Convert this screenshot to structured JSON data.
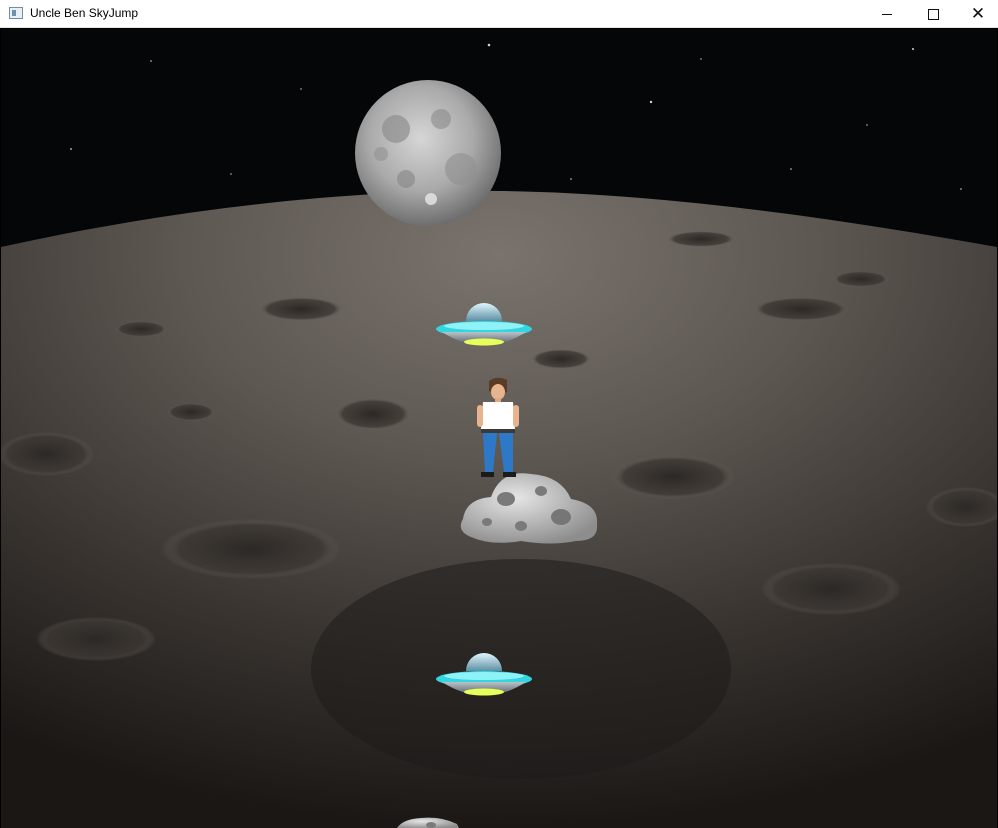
{
  "window": {
    "title": "Uncle Ben SkyJump",
    "app_icon": "window-app-icon",
    "controls": {
      "minimize_icon": "minimize-icon",
      "maximize_icon": "maximize-icon",
      "close_icon": "close-icon"
    }
  },
  "scene": {
    "background": "moon-surface-space",
    "sprites": [
      {
        "type": "full-moon"
      },
      {
        "type": "ufo-platform"
      },
      {
        "type": "player-uncle-ben"
      },
      {
        "type": "asteroid-platform"
      },
      {
        "type": "ufo-platform"
      },
      {
        "type": "asteroid-platform-partial"
      }
    ],
    "colors": {
      "space": "#050608",
      "lunar_surface": "#6a6460",
      "ufo_ring": "#33d6e0",
      "ufo_light": "#e8ff5a",
      "shirt": "#ffffff",
      "jeans": "#2e78c8"
    }
  }
}
